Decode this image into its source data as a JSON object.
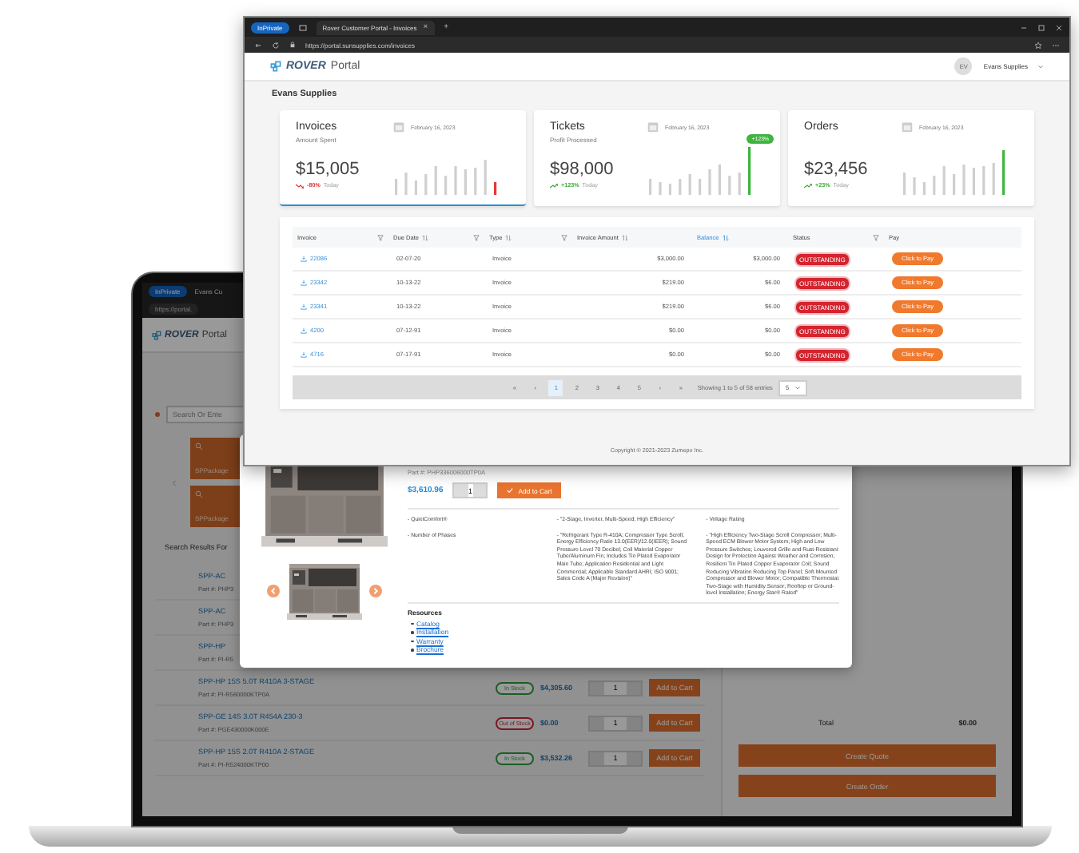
{
  "laptop": {
    "browser": {
      "private_label": "InPrivate",
      "tab_title": "Evans Cu",
      "url": "https://portal."
    },
    "header": {
      "logo": "ROVER",
      "logo_suffix": "Portal"
    },
    "search": {
      "placeholder": "Search Or Ente"
    },
    "tiles": [
      "SPPackage",
      "SPPackage"
    ],
    "results_label": "Search Results For",
    "products": [
      {
        "name": "SPP-AC",
        "part": "Part #: PHP3"
      },
      {
        "name": "SPP-AC",
        "part": "Part #: PHP3"
      },
      {
        "name": "SPP-HP",
        "part": "Part #: PI-R5"
      },
      {
        "name": "SPP-HP 15S 5.0T R410A 3-STAGE",
        "part": "Part #: PI-R560000KTP0A",
        "stock": "In Stock",
        "in_stock": true,
        "price": "$4,305.60",
        "qty": "1",
        "action": "Add to Cart"
      },
      {
        "name": "SPP-GE 14S 3.0T R454A 230-3",
        "part": "Part #: PGE430000K000E",
        "stock": "Out of Stock",
        "in_stock": false,
        "price": "$0.00",
        "qty": "1",
        "action": "Add to Cart"
      },
      {
        "name": "SPP-HP 15S 2.0T R410A 2-STAGE",
        "part": "Part #: PI-R524000KTP00",
        "stock": "In Stock",
        "in_stock": true,
        "price": "$3,532.26",
        "qty": "1",
        "action": "Add to Cart"
      }
    ],
    "summary": {
      "total_label": "Total",
      "total": "$0.00",
      "buttons": [
        "Create Quote",
        "Create Order"
      ]
    }
  },
  "product_modal": {
    "part": "Part #: PHP336006000TP0A",
    "price": "$3,610.96",
    "qty": "1",
    "add_label": "Add to Cart",
    "spec_columns": [
      [
        "- QuietComfort®",
        "- Number of Phases"
      ],
      [
        "- \"2-Stage, Inverter, Multi-Speed, High Efficiency\"",
        "- \"Refrigerant Type R-410A; Compressor Type Scroll; Energy Efficiency Ratio 13.0(EER)/12.0(IEER); Sound Pressure Level 70 Decibel; Coil Material Copper Tube/Aluminum Fin; Includes Tin Plated Evaporator Main Tube; Application Residential and Light Commercial; Applicable Standard AHRI; ISO 9001; Sales Code A (Major Revision)\""
      ],
      [
        "- Voltage Rating",
        "- \"High Efficiency Two-Stage Scroll Compressor; Multi-Speed ECM Blower Motor System; High and Low Pressure Switches; Louvered Grille and Rust-Resistant Design for Protection Against Weather and Corrosion; Resilient Tin Plated Copper Evaporator Coil; Sound Reducing Vibration Reducing Top Panel; Soft Mounted Compressor and Blower Motor; Compatible Thermostat Two-Stage with Humidity Sensor; Rooftop or Ground-level Installation; Energy Star® Rated\""
      ]
    ],
    "resources_title": "Resources",
    "resources": [
      "Catalog",
      "Installation",
      "Warranty",
      "Brochure"
    ]
  },
  "front_window": {
    "browser": {
      "private_label": "InPrivate",
      "tab_title": "Rover Customer Portal - Invoices",
      "tab_close": "×",
      "new_tab": "+",
      "url": "https://portal.sunsupplies.com/invoices"
    },
    "header": {
      "logo": "ROVER",
      "logo_suffix": "Portal",
      "avatar": "EV",
      "account": "Evans Supplies"
    },
    "page_title": "Evans Supplies",
    "cards": [
      {
        "title": "Invoices",
        "subtitle": "Amount Spent",
        "date": "February 16, 2023",
        "value": "$15,005",
        "change": "-80%",
        "negative": true,
        "period": "Today",
        "selected": true
      },
      {
        "title": "Tickets",
        "subtitle": "Profit Processed",
        "date": "February 16, 2023",
        "value": "$98,000",
        "change": "+123%",
        "negative": false,
        "period": "Today",
        "badge": "+123%",
        "selected": false
      },
      {
        "title": "Orders",
        "date": "February 16, 2023",
        "value": "$23,456",
        "change": "+23%",
        "negative": false,
        "period": "Today",
        "selected": false
      }
    ],
    "table": {
      "columns": [
        {
          "label": "Invoice",
          "sortable": false,
          "filterable": true,
          "sorted": false
        },
        {
          "label": "Due Date",
          "sortable": true,
          "filterable": true,
          "sorted": false
        },
        {
          "label": "Type",
          "sortable": true,
          "filterable": true,
          "sorted": false
        },
        {
          "label": "Invoice Amount",
          "sortable": true,
          "filterable": false,
          "sorted": false
        },
        {
          "label": "Balance",
          "sortable": true,
          "filterable": false,
          "sorted": true
        },
        {
          "label": "Status",
          "sortable": false,
          "filterable": true,
          "sorted": false
        },
        {
          "label": "Pay",
          "sortable": false,
          "filterable": false,
          "sorted": false
        }
      ],
      "rows": [
        {
          "invoice": "22086",
          "due": "02-07-20",
          "type": "Invoice",
          "amount": "$3,000.00",
          "balance": "$3,000.00",
          "status": "OUTSTANDING",
          "pay": "Click to Pay"
        },
        {
          "invoice": "23342",
          "due": "10-13-22",
          "type": "Invoice",
          "amount": "$219.00",
          "balance": "$6.00",
          "status": "OUTSTANDING",
          "pay": "Click to Pay"
        },
        {
          "invoice": "23341",
          "due": "10-13-22",
          "type": "Invoice",
          "amount": "$219.00",
          "balance": "$6.00",
          "status": "OUTSTANDING",
          "pay": "Click to Pay"
        },
        {
          "invoice": "4200",
          "due": "07-12-91",
          "type": "Invoice",
          "amount": "$0.00",
          "balance": "$0.00",
          "status": "OUTSTANDING",
          "pay": "Click to Pay"
        },
        {
          "invoice": "4716",
          "due": "07-17-91",
          "type": "Invoice",
          "amount": "$0.00",
          "balance": "$0.00",
          "status": "OUTSTANDING",
          "pay": "Click to Pay"
        }
      ],
      "pagination": {
        "first": "«",
        "prev": "‹",
        "pages": [
          {
            "label": "1",
            "selected": true
          },
          {
            "label": "2",
            "selected": false
          },
          {
            "label": "3",
            "selected": false
          },
          {
            "label": "4",
            "selected": false
          },
          {
            "label": "5",
            "selected": false
          }
        ],
        "next": "›",
        "last": "»",
        "info": "Showing 1 to 5 of 58 entries",
        "page_size": "5"
      }
    },
    "footer": "Copyright © 2021-2023 Zumepo Inc."
  }
}
